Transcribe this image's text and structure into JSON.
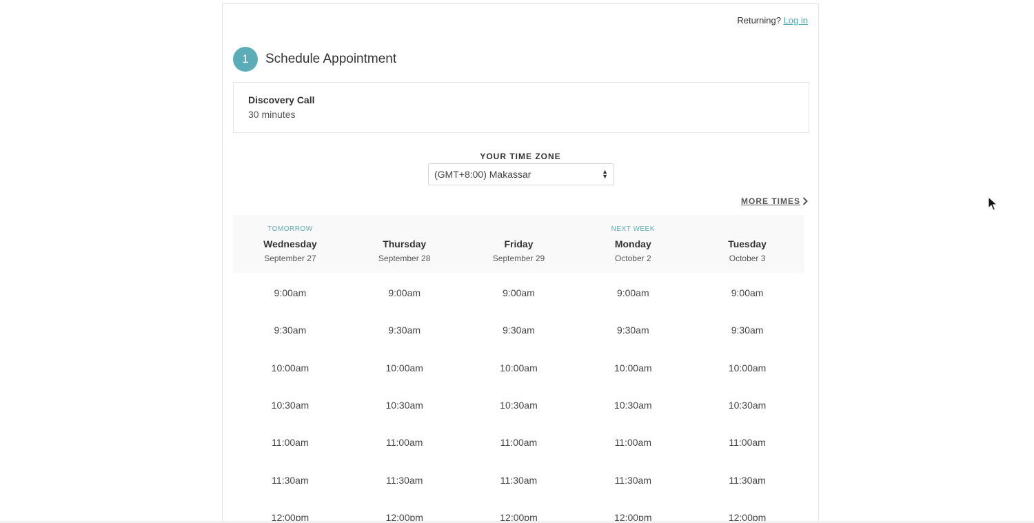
{
  "header": {
    "returning_text": "Returning?",
    "login_link": "Log in"
  },
  "step": {
    "number": "1",
    "title": "Schedule Appointment"
  },
  "appointment": {
    "name": "Discovery Call",
    "duration": "30 minutes"
  },
  "timezone": {
    "label": "YOUR TIME ZONE",
    "selected": "(GMT+8:00) Makassar"
  },
  "more_times": "MORE TIMES",
  "days": [
    {
      "tag": "TOMORROW",
      "name": "Wednesday",
      "date": "September 27"
    },
    {
      "tag": "",
      "name": "Thursday",
      "date": "September 28"
    },
    {
      "tag": "",
      "name": "Friday",
      "date": "September 29"
    },
    {
      "tag": "NEXT WEEK",
      "name": "Monday",
      "date": "October 2"
    },
    {
      "tag": "",
      "name": "Tuesday",
      "date": "October 3"
    }
  ],
  "slots": [
    [
      "9:00am",
      "9:30am",
      "10:00am",
      "10:30am",
      "11:00am",
      "11:30am",
      "12:00pm"
    ],
    [
      "9:00am",
      "9:30am",
      "10:00am",
      "10:30am",
      "11:00am",
      "11:30am",
      "12:00pm"
    ],
    [
      "9:00am",
      "9:30am",
      "10:00am",
      "10:30am",
      "11:00am",
      "11:30am",
      "12:00pm"
    ],
    [
      "9:00am",
      "9:30am",
      "10:00am",
      "10:30am",
      "11:00am",
      "11:30am",
      "12:00pm"
    ],
    [
      "9:00am",
      "9:30am",
      "10:00am",
      "10:30am",
      "11:00am",
      "11:30am",
      "12:00pm"
    ]
  ],
  "colors": {
    "accent": "#5aadb7",
    "link": "#4ea9b5",
    "header_bg": "#f9f9f9"
  },
  "icons": {
    "select": "select-arrows-icon",
    "more_times": "chevron-right-icon",
    "cursor": "mouse-pointer-icon"
  }
}
